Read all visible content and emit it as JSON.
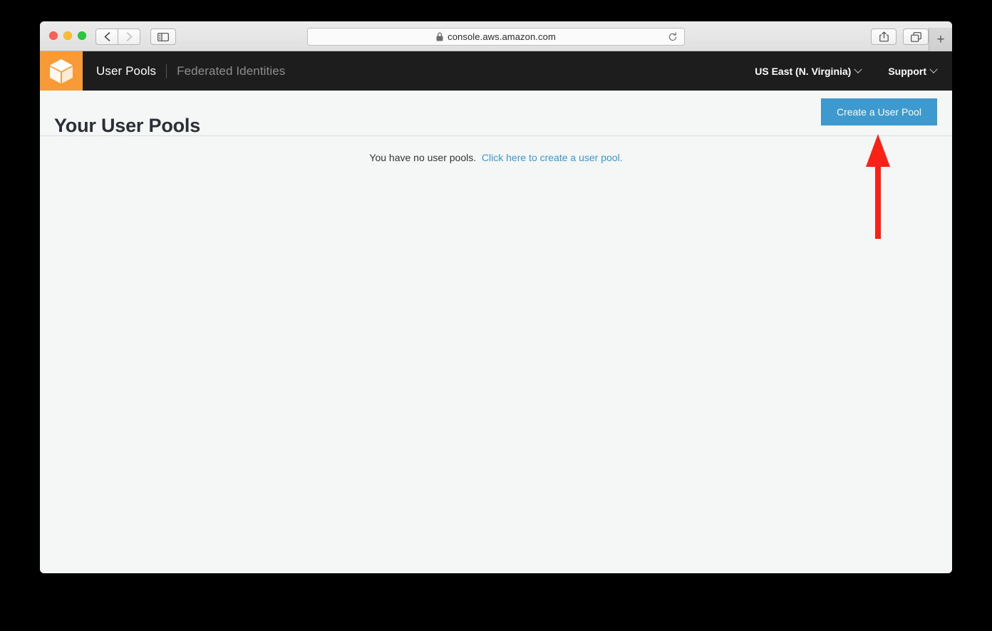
{
  "browser": {
    "traffic_lights": [
      "close",
      "minimize",
      "zoom"
    ],
    "back_label": "back-arrow-icon",
    "forward_label": "forward-arrow-icon",
    "sidebar_toggle_label": "sidebar-toggle-icon",
    "url": "console.aws.amazon.com",
    "url_secure_icon": "lock-icon",
    "reload_label": "reload-icon",
    "share_label": "share-icon",
    "tabs_label": "show-tabs-icon",
    "new_tab_label": "+"
  },
  "header": {
    "logo_icon": "cognito-cube-icon",
    "logo_color": "#f89b36",
    "background_color": "#1d1d1d",
    "nav": [
      {
        "label": "User Pools",
        "active": true
      },
      {
        "label": "Federated Identities",
        "active": false
      }
    ],
    "region": "US East (N. Virginia)",
    "support": "Support"
  },
  "page": {
    "title": "Your User Pools",
    "create_button": "Create a User Pool",
    "create_button_color": "#3d99ce"
  },
  "content": {
    "empty_message": "You have no user pools.",
    "empty_link": "Click here to create a user pool.",
    "link_color": "#3b97d3"
  },
  "annotation": {
    "arrow_color": "#fa2116",
    "arrow_direction": "up",
    "points_at": "Create a User Pool"
  }
}
